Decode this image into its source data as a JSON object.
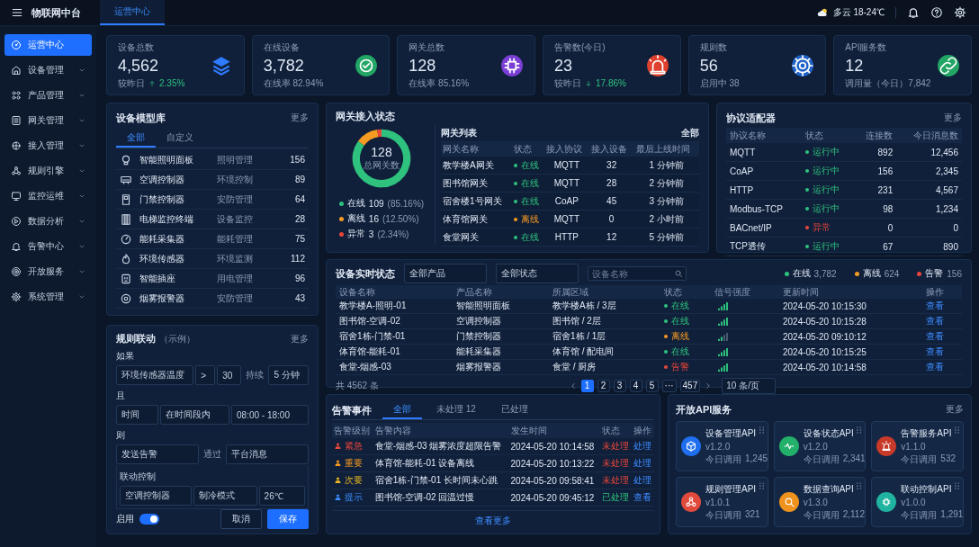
{
  "topbar": {
    "title": "物联网中台",
    "tabs": [
      {
        "label": "运营中心",
        "selected": true
      }
    ],
    "weather": "多云 18-24℃"
  },
  "sidebar": {
    "items": [
      {
        "label": "运营中心",
        "selected": true,
        "expandable": false
      },
      {
        "label": "设备管理",
        "selected": false,
        "expandable": true
      },
      {
        "label": "产品管理",
        "selected": false,
        "expandable": true
      },
      {
        "label": "网关管理",
        "selected": false,
        "expandable": true
      },
      {
        "label": "接入管理",
        "selected": false,
        "expandable": true
      },
      {
        "label": "规则引擎",
        "selected": false,
        "expandable": true
      },
      {
        "label": "监控运维",
        "selected": false,
        "expandable": true
      },
      {
        "label": "数据分析",
        "selected": false,
        "expandable": true
      },
      {
        "label": "告警中心",
        "selected": false,
        "expandable": true
      },
      {
        "label": "开放服务",
        "selected": false,
        "expandable": true
      },
      {
        "label": "系统管理",
        "selected": false,
        "expandable": true
      }
    ]
  },
  "stats": [
    {
      "label": "设备总数",
      "value": "4,562",
      "note": "较昨日",
      "rising": true,
      "change": "2.35%"
    },
    {
      "label": "在线设备",
      "value": "3,782",
      "note": "在线率 82.94%"
    },
    {
      "label": "网关总数",
      "value": "128",
      "note": "在线率 85.16%"
    },
    {
      "label": "告警数(今日)",
      "value": "23",
      "note": "较昨日",
      "rising": false,
      "change": "17.86%"
    },
    {
      "label": "规则数",
      "value": "56",
      "note": "启用中 38"
    },
    {
      "label": "API服务数",
      "value": "12",
      "note": "调用量（今日）7,842"
    }
  ],
  "models": {
    "title": "设备模型库",
    "more": "更多",
    "tabs": [
      {
        "label": "全部",
        "selected": true
      },
      {
        "label": "自定义",
        "selected": false
      }
    ],
    "rows": [
      {
        "name": "智能照明面板",
        "category": "照明管理",
        "count": "156"
      },
      {
        "name": "空调控制器",
        "category": "环境控制",
        "count": "89"
      },
      {
        "name": "门禁控制器",
        "category": "安防管理",
        "count": "64"
      },
      {
        "name": "电梯监控终端",
        "category": "设备监控",
        "count": "28"
      },
      {
        "name": "能耗采集器",
        "category": "能耗管理",
        "count": "75"
      },
      {
        "name": "环境传感器",
        "category": "环境监测",
        "count": "112"
      },
      {
        "name": "智能插座",
        "category": "用电管理",
        "count": "96"
      },
      {
        "name": "烟雾报警器",
        "category": "安防管理",
        "count": "43"
      }
    ]
  },
  "rule": {
    "title": "规则联动",
    "subtitle": "（示例）",
    "more": "更多",
    "conditions": [
      {
        "label": "如果",
        "fields": [
          {
            "kind": "select",
            "value": "环境传感器温度"
          },
          {
            "kind": "select",
            "value": ">"
          },
          {
            "kind": "select",
            "value": "30"
          },
          {
            "kind": "label",
            "value": "持续"
          },
          {
            "kind": "select",
            "value": "5 分钟"
          }
        ]
      },
      {
        "label": "且",
        "fields": [
          {
            "kind": "select",
            "value": "时间"
          },
          {
            "kind": "select",
            "value": "在时间段内"
          },
          {
            "kind": "select",
            "value": "08:00 - 18:00"
          }
        ]
      },
      {
        "label": "则",
        "fields": [
          {
            "kind": "select",
            "value": "发送告警"
          },
          {
            "kind": "label",
            "value": "通过"
          },
          {
            "kind": "select",
            "value": "平台消息"
          }
        ]
      }
    ],
    "linkage": {
      "label": "联动控制",
      "fields": [
        {
          "kind": "select",
          "value": "空调控制器"
        },
        {
          "kind": "select",
          "value": "制冷模式"
        },
        {
          "kind": "select",
          "value": "26℃"
        }
      ]
    },
    "enable": {
      "label": "启用",
      "on": true
    },
    "buttons": [
      {
        "label": "取消",
        "kind": "secondary"
      },
      {
        "label": "保存",
        "kind": "primary"
      }
    ]
  },
  "gateway": {
    "title": "网关接入状态",
    "chart_data": {
      "type": "donut",
      "categories": [
        "在线",
        "离线",
        "异常"
      ],
      "values": [
        85.16,
        12.5,
        2.34
      ]
    },
    "total": "128",
    "total_label": "总网关数",
    "legend": [
      {
        "count": "109",
        "share": "(85.16%)",
        "color": "#2ec27e"
      },
      {
        "count": "16",
        "share": "(12.50%)",
        "color": "#f59a23"
      },
      {
        "count": "3",
        "share": "(2.34%)",
        "color": "#e8463a"
      }
    ],
    "list": {
      "title": "网关列表",
      "filter": "全部",
      "columns": [
        "网关名称",
        "状态",
        "接入协议",
        "接入设备",
        "最后上线时间"
      ],
      "rows": [
        {
          "name": "教学楼A网关",
          "status": "在线",
          "online": true,
          "protocol": "MQTT",
          "devices": "32",
          "last_online": "1 分钟前"
        },
        {
          "name": "图书馆网关",
          "status": "在线",
          "online": true,
          "protocol": "MQTT",
          "devices": "28",
          "last_online": "2 分钟前"
        },
        {
          "name": "宿舍楼1号网关",
          "status": "在线",
          "online": true,
          "protocol": "CoAP",
          "devices": "45",
          "last_online": "3 分钟前"
        },
        {
          "name": "体育馆网关",
          "status": "离线",
          "online": false,
          "protocol": "MQTT",
          "devices": "0",
          "last_online": "2 小时前"
        },
        {
          "name": "食堂网关",
          "status": "在线",
          "online": true,
          "protocol": "HTTP",
          "devices": "12",
          "last_online": "5 分钟前"
        }
      ]
    }
  },
  "protocols": {
    "title": "协议适配器",
    "more": "更多",
    "columns": [
      "协议名称",
      "状态",
      "连接数",
      "今日消息数"
    ],
    "rows": [
      {
        "name": "MQTT",
        "status": "运行中",
        "running": true,
        "connections": "892",
        "messages": "12,456"
      },
      {
        "name": "CoAP",
        "status": "运行中",
        "running": true,
        "connections": "156",
        "messages": "2,345"
      },
      {
        "name": "HTTP",
        "status": "运行中",
        "running": true,
        "connections": "231",
        "messages": "4,567"
      },
      {
        "name": "Modbus-TCP",
        "status": "运行中",
        "running": true,
        "connections": "98",
        "messages": "1,234"
      },
      {
        "name": "BACnet/IP",
        "status": "异常",
        "running": false,
        "connections": "0",
        "messages": "0"
      },
      {
        "name": "TCP透传",
        "status": "运行中",
        "running": true,
        "connections": "67",
        "messages": "890"
      }
    ]
  },
  "realtime": {
    "title": "设备实时状态",
    "filters": [
      {
        "value": "全部产品"
      },
      {
        "value": "全部状态"
      }
    ],
    "search": {
      "placeholder": "设备名称"
    },
    "summary": [
      {
        "label": "在线",
        "count": "3,782",
        "color": "#2ec27e"
      },
      {
        "label": "离线",
        "count": "624",
        "color": "#f59a23"
      },
      {
        "label": "告警",
        "count": "156",
        "color": "#e8463a"
      }
    ],
    "columns": [
      "设备名称",
      "产品名称",
      "所属区域",
      "状态",
      "信号强度",
      "更新时间",
      "操作"
    ],
    "rows": [
      {
        "device": "教学楼A-照明-01",
        "product": "智能照明面板",
        "area": "教学楼A栋 / 3层",
        "status": "在线",
        "color": "#2ec27e",
        "signal_weak": false,
        "time": "2024-05-20 10:15:30",
        "action": "查看"
      },
      {
        "device": "图书馆-空调-02",
        "product": "空调控制器",
        "area": "图书馆 / 2层",
        "status": "在线",
        "color": "#2ec27e",
        "signal_weak": false,
        "time": "2024-05-20 10:15:28",
        "action": "查看"
      },
      {
        "device": "宿舍1栋-门禁-01",
        "product": "门禁控制器",
        "area": "宿舍1栋 / 1层",
        "status": "离线",
        "color": "#f59a23",
        "signal_weak": true,
        "time": "2024-05-20 09:10:12",
        "action": "查看"
      },
      {
        "device": "体育馆-能耗-01",
        "product": "能耗采集器",
        "area": "体育馆 / 配电间",
        "status": "在线",
        "color": "#2ec27e",
        "signal_weak": false,
        "time": "2024-05-20 10:15:25",
        "action": "查看"
      },
      {
        "device": "食堂-烟感-03",
        "product": "烟雾报警器",
        "area": "食堂 / 厨房",
        "status": "告警",
        "color": "#e8463a",
        "signal_weak": false,
        "time": "2024-05-20 10:14:58",
        "action": "查看"
      }
    ],
    "total": "共 4562 条",
    "pages": [
      {
        "label": "1",
        "selected": true
      },
      {
        "label": "2",
        "selected": false
      },
      {
        "label": "3",
        "selected": false
      },
      {
        "label": "4",
        "selected": false
      },
      {
        "label": "5",
        "selected": false
      },
      {
        "label": "···",
        "selected": false
      },
      {
        "label": "457",
        "selected": false
      }
    ],
    "page_size": "10 条/页"
  },
  "alarms": {
    "title": "告警事件",
    "tabs": [
      {
        "label": "全部",
        "selected": true
      },
      {
        "label": "未处理 12",
        "selected": false
      },
      {
        "label": "已处理",
        "selected": false
      }
    ],
    "columns": [
      "告警级别",
      "告警内容",
      "发生时间",
      "状态",
      "操作"
    ],
    "rows": [
      {
        "level": "紧急",
        "color": "#e8463a",
        "content": "食堂-烟感-03 烟雾浓度超限告警",
        "time": "2024-05-20 10:14:58",
        "status": "未处理",
        "handled": false,
        "action": "处理"
      },
      {
        "level": "重要",
        "color": "#f59a23",
        "content": "体育馆-能耗-01 设备离线",
        "time": "2024-05-20 10:13:22",
        "status": "未处理",
        "handled": false,
        "action": "处理"
      },
      {
        "level": "次要",
        "color": "#e8b923",
        "content": "宿舍1栋-门禁-01 长时间未心跳",
        "time": "2024-05-20 09:58:41",
        "status": "未处理",
        "handled": false,
        "action": "处理"
      },
      {
        "level": "提示",
        "color": "#3b8cff",
        "content": "图书馆-空调-02 回温过慢",
        "time": "2024-05-20 09:45:12",
        "status": "已处理",
        "handled": true,
        "action": "查看"
      }
    ],
    "more": "查看更多"
  },
  "apis": {
    "title": "开放API服务",
    "more": "更多",
    "services": [
      {
        "name": "设备管理API",
        "version": "v1.2.0",
        "calls_label": "今日调用",
        "calls": "1,245"
      },
      {
        "name": "设备状态API",
        "version": "v1.2.0",
        "calls_label": "今日调用",
        "calls": "2,341"
      },
      {
        "name": "告警服务API",
        "version": "v1.1.0",
        "calls_label": "今日调用",
        "calls": "532"
      },
      {
        "name": "规则管理API",
        "version": "v1.0.1",
        "calls_label": "今日调用",
        "calls": "321"
      },
      {
        "name": "数据查询API",
        "version": "v1.3.0",
        "calls_label": "今日调用",
        "calls": "2,112"
      },
      {
        "name": "联动控制API",
        "version": "v1.0.0",
        "calls_label": "今日调用",
        "calls": "1,291"
      }
    ]
  }
}
